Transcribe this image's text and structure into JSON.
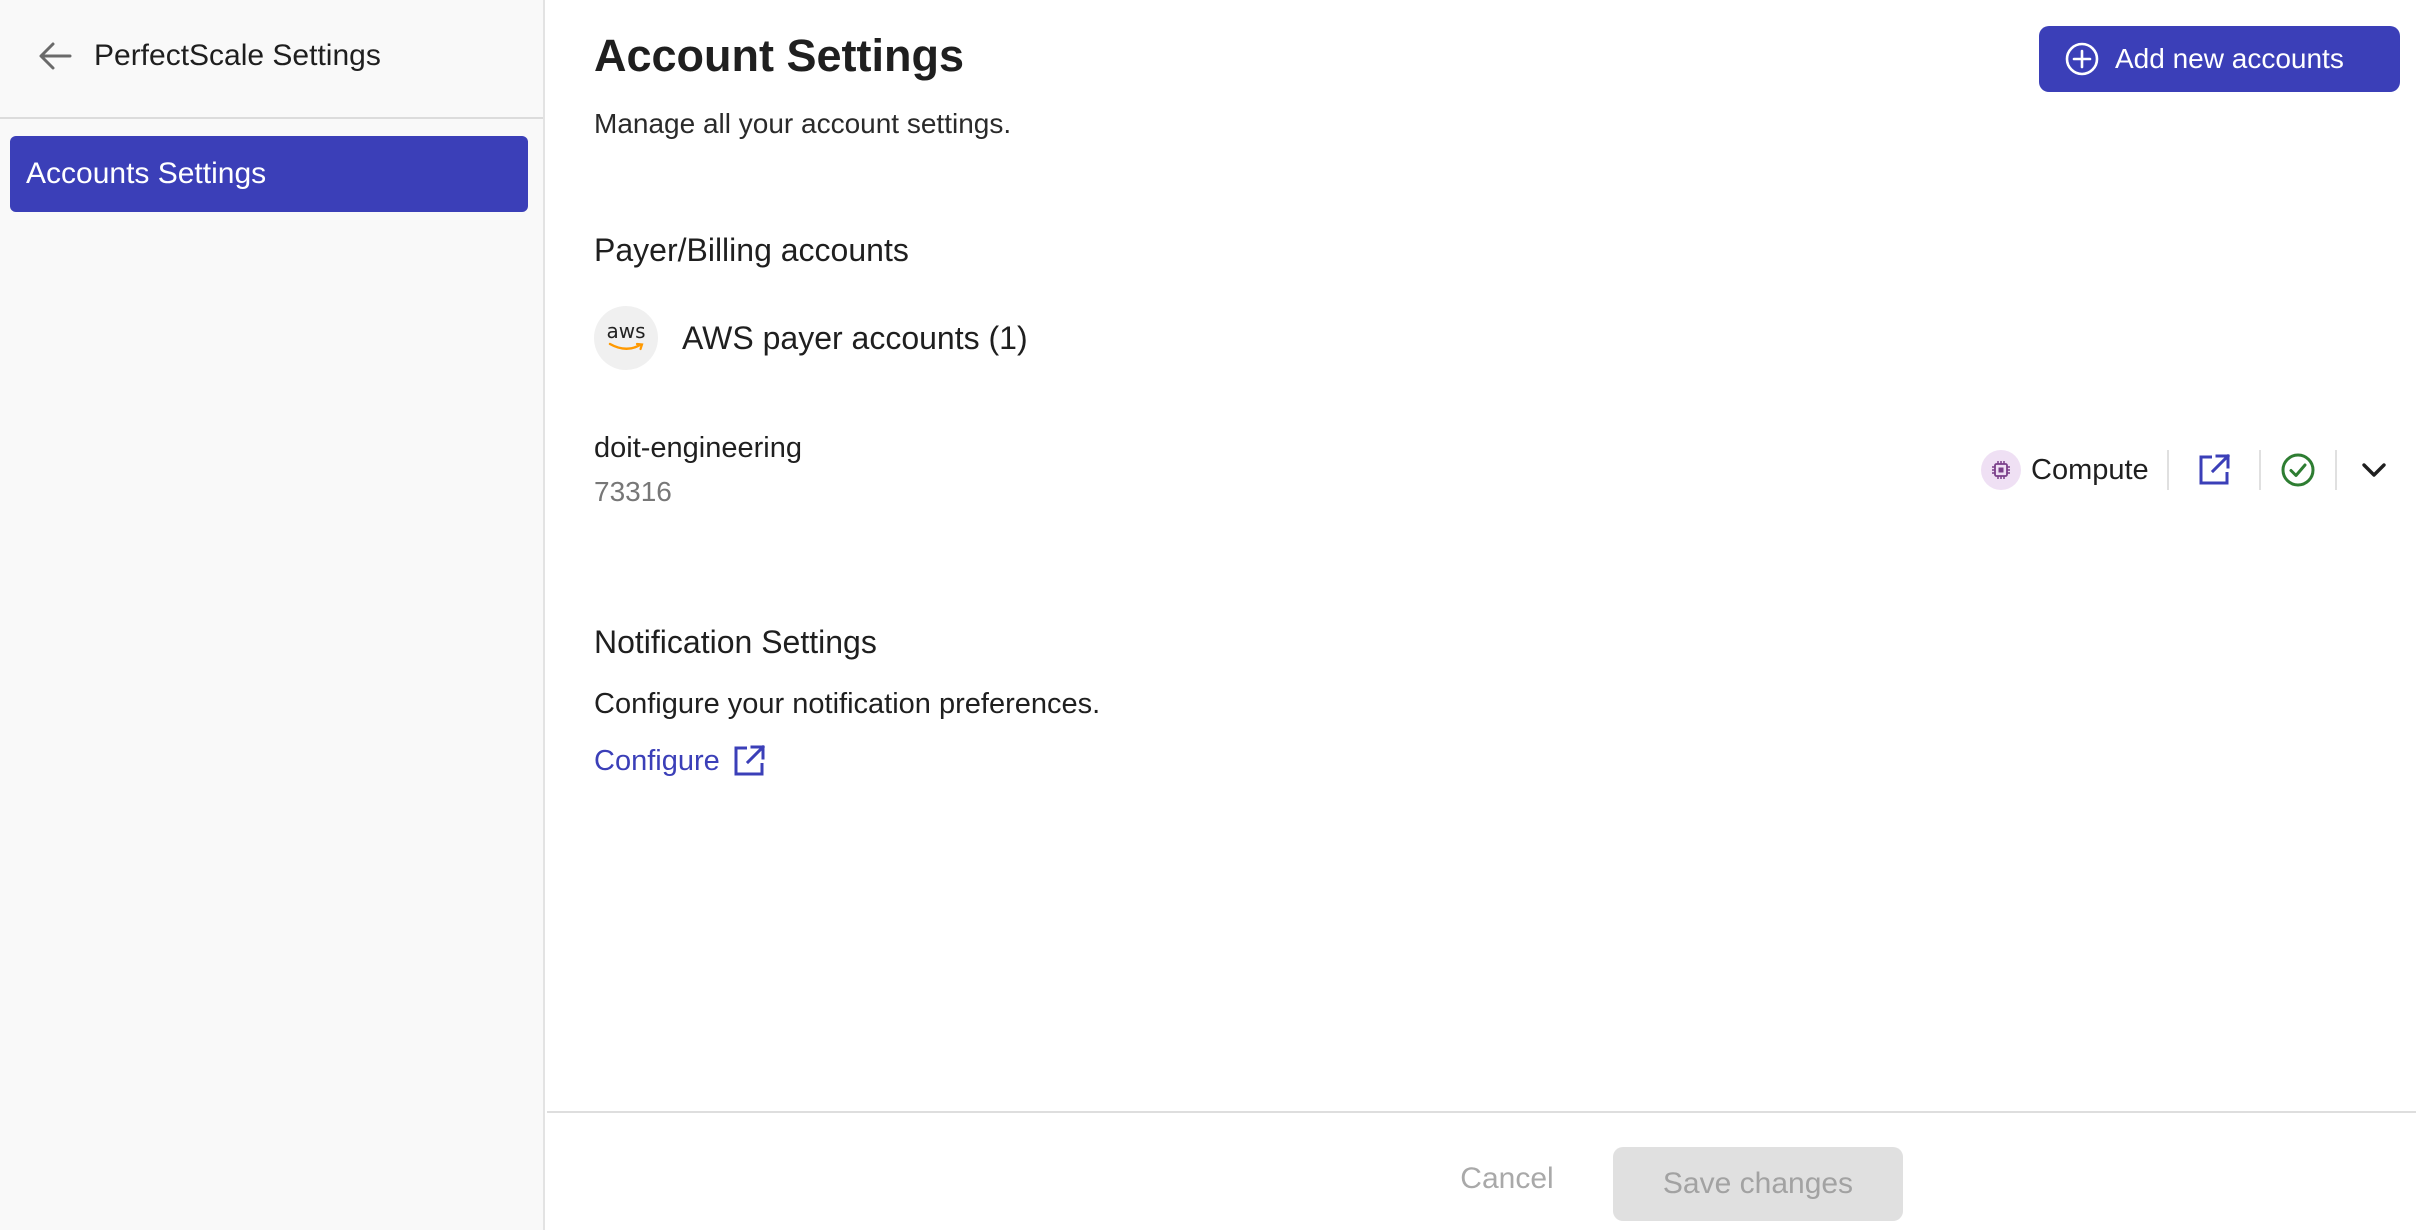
{
  "sidebar": {
    "title": "PerfectScale Settings",
    "items": [
      {
        "label": "Accounts Settings",
        "active": true
      }
    ]
  },
  "header": {
    "title": "Account Settings",
    "subtitle": "Manage all your account settings.",
    "add_button_label": "Add new accounts"
  },
  "payer": {
    "section_title": "Payer/Billing accounts",
    "provider_logo_text": "aws",
    "provider_label": "AWS payer accounts (1)",
    "account": {
      "name": "doit-engineering",
      "id": "73316",
      "tag": "Compute",
      "status": "connected"
    }
  },
  "notifications": {
    "section_title": "Notification Settings",
    "description": "Configure your notification preferences.",
    "link_label": "Configure"
  },
  "footer": {
    "cancel_label": "Cancel",
    "save_label": "Save changes"
  },
  "colors": {
    "accent": "#3b3fb8",
    "success": "#2e7d32",
    "compute_badge_bg": "#efe0f4",
    "aws_orange": "#ff9900"
  },
  "icons": [
    "arrow-left-icon",
    "plus-circle-icon",
    "chip-icon",
    "external-link-icon",
    "check-circle-icon",
    "chevron-down-icon"
  ]
}
